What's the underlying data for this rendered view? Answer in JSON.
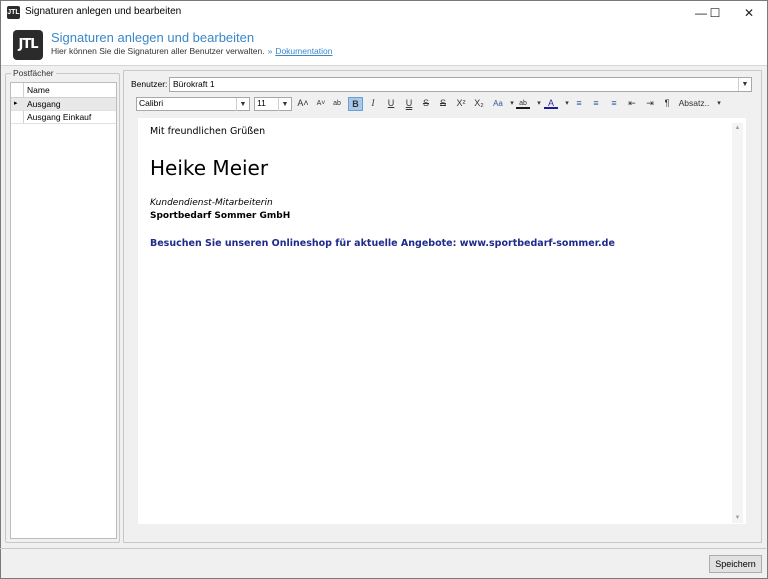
{
  "window": {
    "title": "Signaturen anlegen und bearbeiten",
    "app_icon_text": "JTL"
  },
  "window_controls": {
    "minimize": "—",
    "maximize": "☐",
    "close": "✕"
  },
  "header": {
    "logo_text": "JTL",
    "title": "Signaturen anlegen und bearbeiten",
    "subtitle": "Hier können Sie die Signaturen aller Benutzer verwalten.",
    "separator": "»",
    "doc_link": "Dokumentation"
  },
  "sidebar": {
    "group_title": "Postfächer",
    "column_header": "Name",
    "rows": [
      "Ausgang",
      "Ausgang Einkauf"
    ],
    "selected_index": 0,
    "row_marker": "▸"
  },
  "user": {
    "label": "Benutzer:",
    "value": "Bürokraft 1"
  },
  "toolbar": {
    "font": "Calibri",
    "size": "11",
    "bold_active": true,
    "items": {
      "grow": "A˄",
      "shrink": "A˅",
      "highlight": "ab",
      "bold": "B",
      "italic": "I",
      "underline": "U",
      "double_underline": "U",
      "strike": "S",
      "double_strike": "S",
      "superscript": "X²",
      "subscript": "X₂",
      "case": "Aa",
      "text_color": "A",
      "list_bullets": "≡",
      "list_numbers": "≡",
      "list_multi": "≡",
      "indent_less": "⇤",
      "indent_more": "⇥",
      "paragraph": "¶",
      "absatz": "Absatz.."
    },
    "dropdown": "▾"
  },
  "signature": {
    "greeting": "Mit freundlichen Grüßen",
    "name": "Heike Meier",
    "role": "Kundendienst-Mitarbeiterin",
    "company": "Sportbedarf Sommer GmbH",
    "shop_line": "Besuchen Sie unseren Onlineshop für aktuelle Angebote: www.sportbedarf-sommer.de"
  },
  "footer": {
    "save_label": "Speichern"
  }
}
